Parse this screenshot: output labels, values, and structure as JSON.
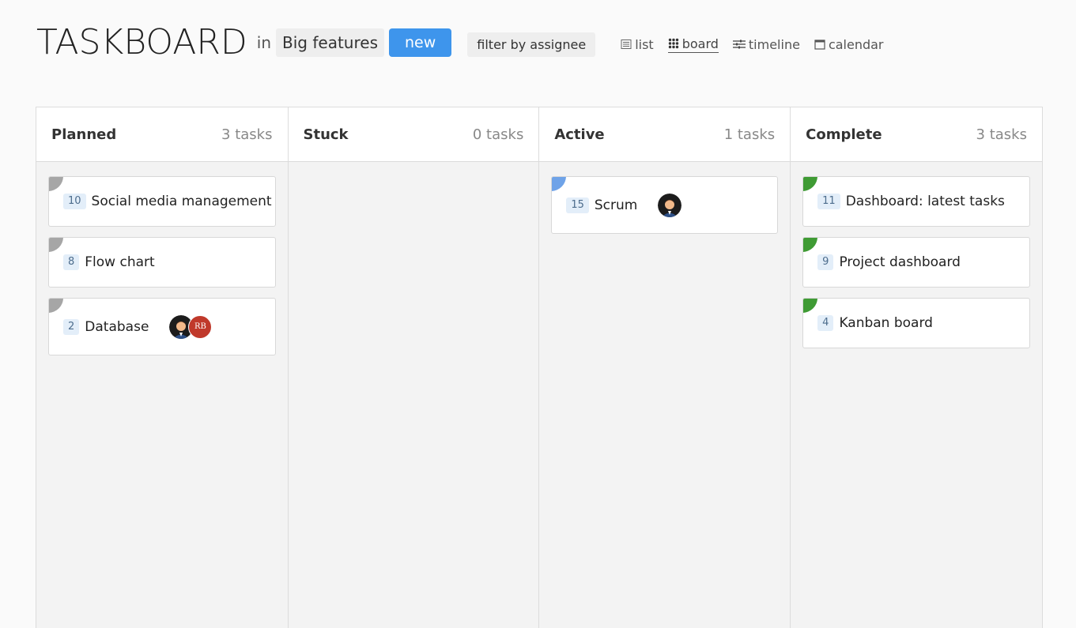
{
  "header": {
    "title": "TASKBOARD",
    "in_label": "in",
    "project": "Big features",
    "new_label": "new",
    "filter_label": "filter by assignee"
  },
  "views": [
    {
      "label": "list",
      "icon": "list-icon",
      "active": false
    },
    {
      "label": "board",
      "icon": "board-grid-icon",
      "active": true
    },
    {
      "label": "timeline",
      "icon": "timeline-icon",
      "active": false
    },
    {
      "label": "calendar",
      "icon": "calendar-icon",
      "active": false
    }
  ],
  "colors": {
    "accent": "#3e95ec",
    "planned": "#a6a6a6",
    "active": "#6fa3e8",
    "complete": "#3f9b34",
    "initials_avatar": "#c0392b"
  },
  "columns": [
    {
      "title": "Planned",
      "count": "3 tasks",
      "cards": [
        {
          "num": "10",
          "title": "Social media management"
        },
        {
          "num": "8",
          "title": "Flow chart"
        },
        {
          "num": "2",
          "title": "Database",
          "avatars": [
            "person-avatar",
            "RB"
          ]
        }
      ]
    },
    {
      "title": "Stuck",
      "count": "0 tasks",
      "cards": []
    },
    {
      "title": "Active",
      "count": "1 tasks",
      "cards": [
        {
          "num": "15",
          "title": "Scrum",
          "avatars": [
            "person-avatar"
          ]
        }
      ]
    },
    {
      "title": "Complete",
      "count": "3 tasks",
      "cards": [
        {
          "num": "11",
          "title": "Dashboard: latest tasks"
        },
        {
          "num": "9",
          "title": "Project dashboard"
        },
        {
          "num": "4",
          "title": "Kanban board"
        }
      ]
    }
  ]
}
